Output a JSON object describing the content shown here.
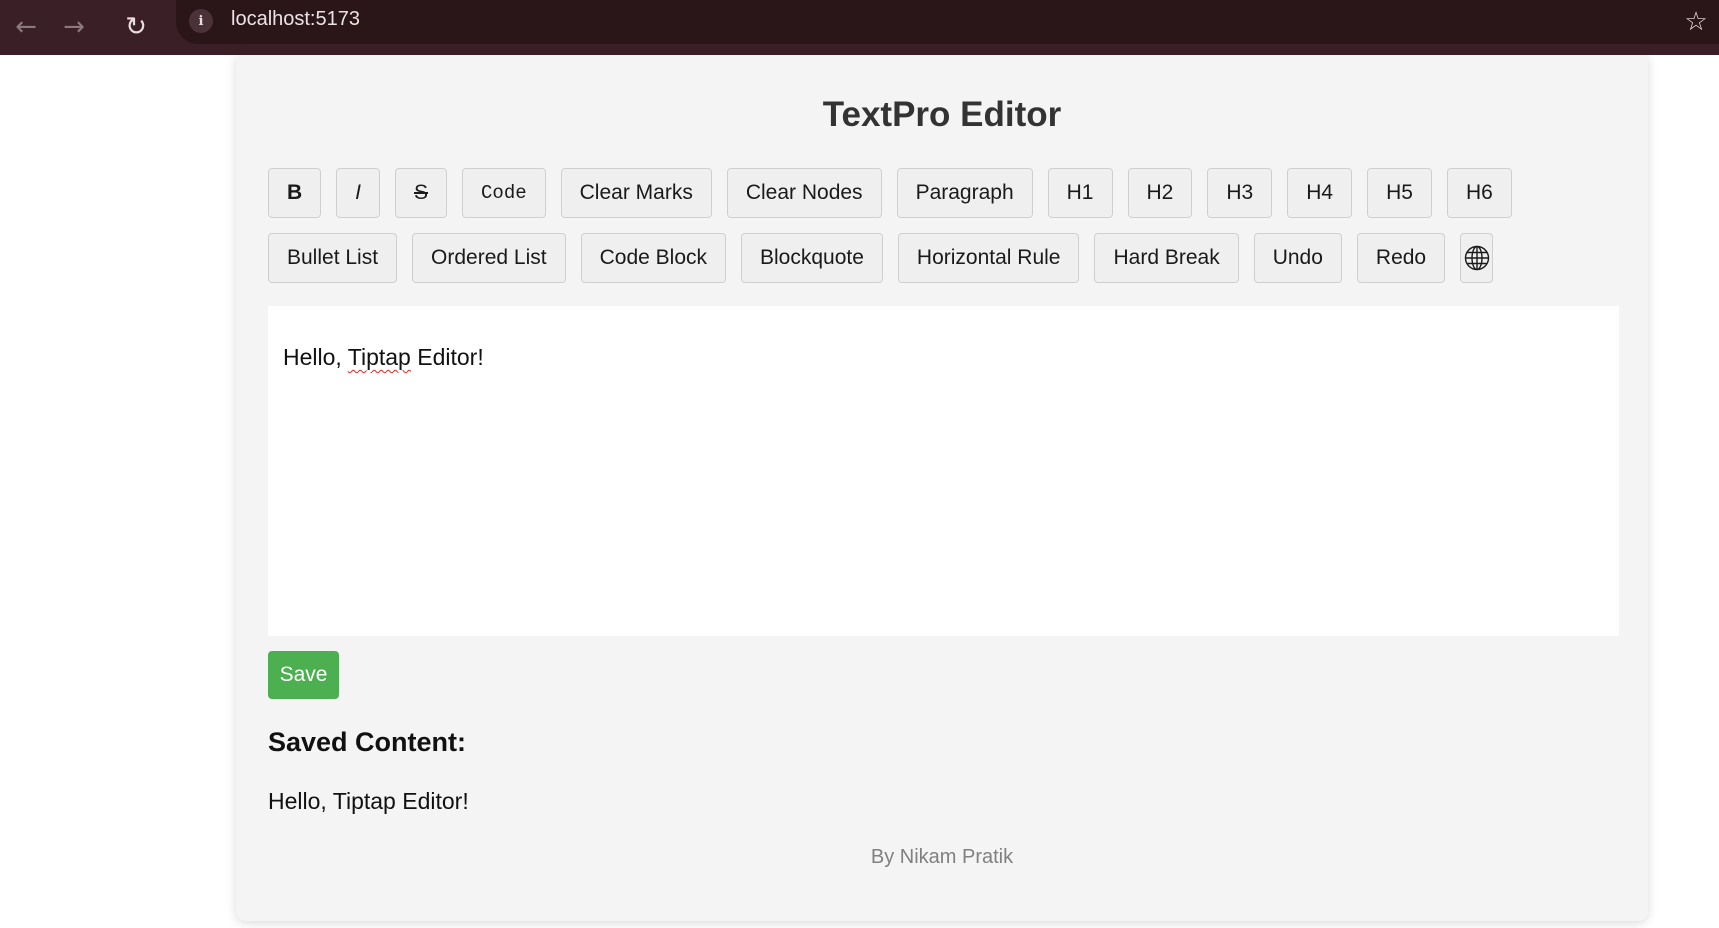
{
  "browser": {
    "back_icon": "←",
    "forward_icon": "→",
    "reload_icon": "↻",
    "info_icon": "i",
    "url": "localhost:5173",
    "bookmark_icon": "☆"
  },
  "app": {
    "title": "TextPro Editor"
  },
  "toolbar": {
    "row1": [
      {
        "label": "B"
      },
      {
        "label": "I"
      },
      {
        "label": "S"
      },
      {
        "label": "Code"
      },
      {
        "label": "Clear Marks"
      },
      {
        "label": "Clear Nodes"
      },
      {
        "label": "Paragraph"
      },
      {
        "label": "H1"
      },
      {
        "label": "H2"
      },
      {
        "label": "H3"
      },
      {
        "label": "H4"
      },
      {
        "label": "H5"
      },
      {
        "label": "H6"
      }
    ],
    "row2": [
      {
        "label": "Bullet List"
      },
      {
        "label": "Ordered List"
      },
      {
        "label": "Code Block"
      },
      {
        "label": "Blockquote"
      },
      {
        "label": "Horizontal Rule"
      },
      {
        "label": "Hard Break"
      },
      {
        "label": "Undo"
      },
      {
        "label": "Redo"
      }
    ],
    "globe_icon": "globe-icon"
  },
  "editor": {
    "text_before": "Hello, ",
    "text_misspelled": "Tiptap",
    "text_after": " Editor!"
  },
  "save_label": "Save",
  "saved": {
    "heading": "Saved Content:",
    "content": "Hello, Tiptap Editor!"
  },
  "footer": "By Nikam Pratik",
  "colors": {
    "browser_bar": "#3b1f26",
    "save_button": "#4caf50",
    "card_background": "#f4f4f4"
  }
}
